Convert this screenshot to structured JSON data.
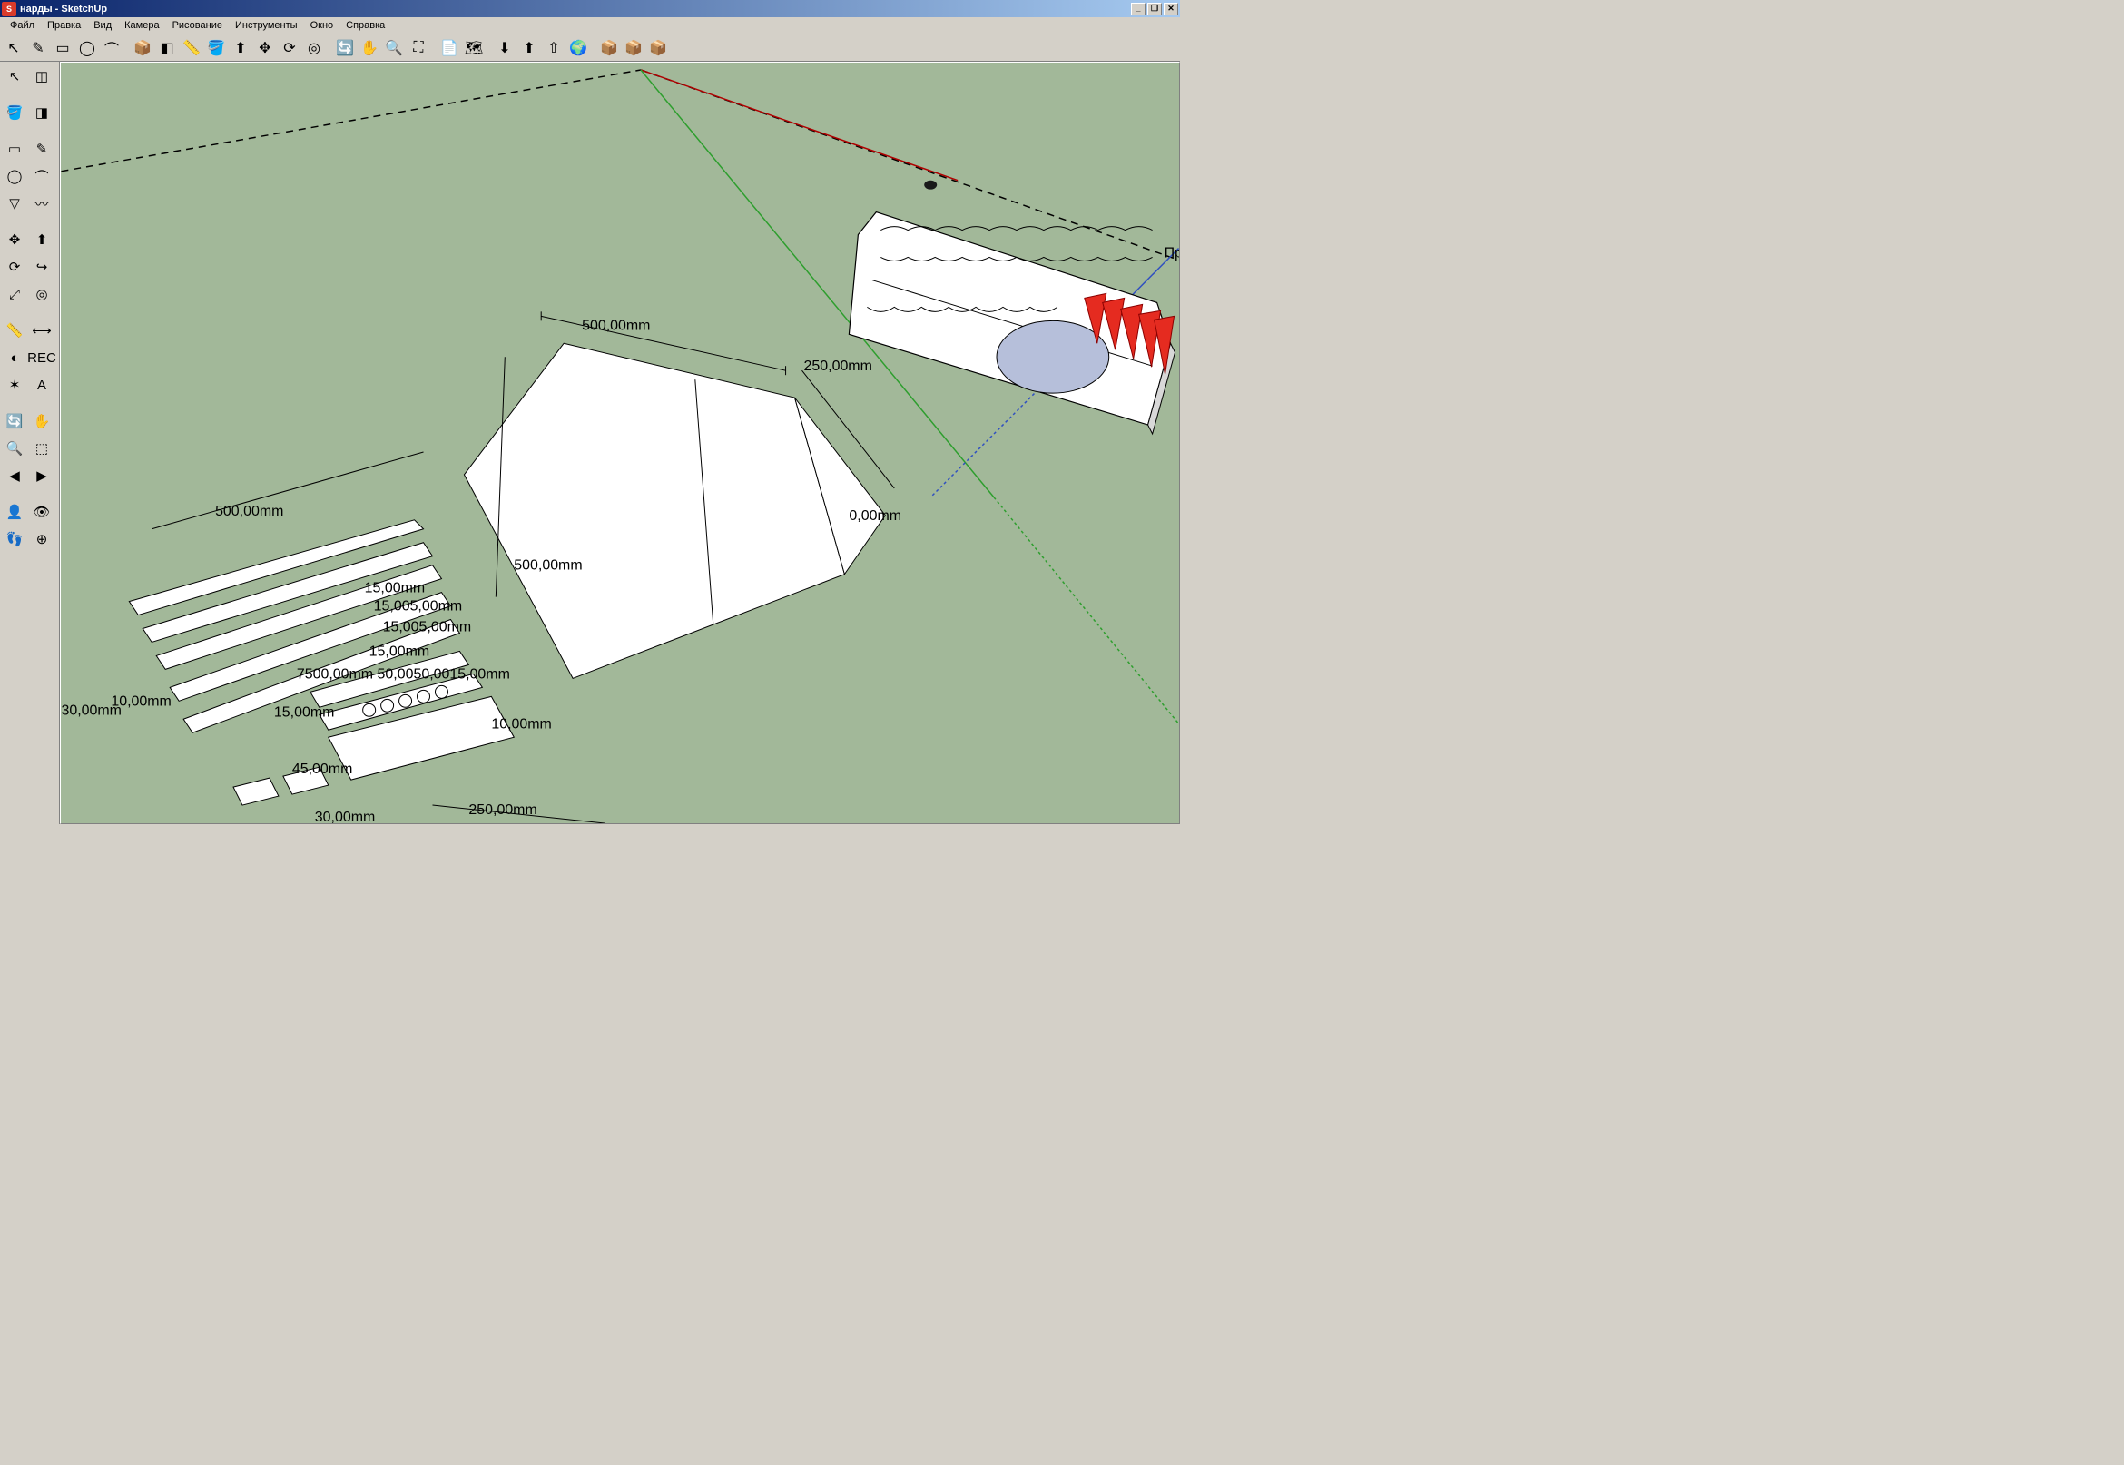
{
  "titlebar": {
    "app_icon_label": "S",
    "title": "нарды - SketchUp"
  },
  "win_buttons": {
    "min": "_",
    "max": "❐",
    "close": "✕"
  },
  "menubar": [
    "Файл",
    "Правка",
    "Вид",
    "Камера",
    "Рисование",
    "Инструменты",
    "Окно",
    "Справка"
  ],
  "top_tools": [
    {
      "name": "select-arrow",
      "glyph": "↖"
    },
    {
      "name": "line-tool",
      "glyph": "✎"
    },
    {
      "name": "rectangle-tool",
      "glyph": "▭"
    },
    {
      "name": "circle-tool",
      "glyph": "◯"
    },
    {
      "name": "arc-tool",
      "glyph": "⌒"
    },
    {
      "sep": true
    },
    {
      "name": "make-component",
      "glyph": "📦"
    },
    {
      "name": "eraser-tool",
      "glyph": "◧"
    },
    {
      "name": "tape-measure",
      "glyph": "📏"
    },
    {
      "name": "paint-bucket",
      "glyph": "🪣"
    },
    {
      "name": "push-pull",
      "glyph": "⬆"
    },
    {
      "name": "move-tool",
      "glyph": "✥"
    },
    {
      "name": "rotate-tool",
      "glyph": "⟳"
    },
    {
      "name": "offset-tool",
      "glyph": "◎"
    },
    {
      "sep": true
    },
    {
      "name": "orbit-tool",
      "glyph": "🔄"
    },
    {
      "name": "pan-tool",
      "glyph": "✋"
    },
    {
      "name": "zoom-tool",
      "glyph": "🔍"
    },
    {
      "name": "zoom-extents",
      "glyph": "⛶"
    },
    {
      "sep": true
    },
    {
      "name": "add-location",
      "glyph": "📄"
    },
    {
      "name": "toggle-terrain",
      "glyph": "🗺"
    },
    {
      "sep": true
    },
    {
      "name": "get-models",
      "glyph": "⬇"
    },
    {
      "name": "share-model",
      "glyph": "⬆"
    },
    {
      "name": "upload-component",
      "glyph": "⇧"
    },
    {
      "name": "preview-ge",
      "glyph": "🌍"
    },
    {
      "sep": true
    },
    {
      "name": "extension-1",
      "glyph": "📦"
    },
    {
      "name": "extension-2",
      "glyph": "📦"
    },
    {
      "name": "extension-3",
      "glyph": "📦"
    }
  ],
  "side_tools": [
    [
      {
        "name": "select-tool",
        "glyph": "↖"
      },
      {
        "name": "component-tool",
        "glyph": "◫"
      }
    ],
    "gap",
    [
      {
        "name": "paint-bucket-side",
        "glyph": "🪣"
      },
      {
        "name": "eraser-side",
        "glyph": "◨"
      }
    ],
    "gap",
    [
      {
        "name": "rectangle-side",
        "glyph": "▭"
      },
      {
        "name": "line-side",
        "glyph": "✎"
      }
    ],
    [
      {
        "name": "circle-side",
        "glyph": "◯"
      },
      {
        "name": "arc-side",
        "glyph": "⌒"
      }
    ],
    [
      {
        "name": "polygon-side",
        "glyph": "▽"
      },
      {
        "name": "freehand-side",
        "glyph": "〰"
      }
    ],
    "gap",
    [
      {
        "name": "move-side",
        "glyph": "✥"
      },
      {
        "name": "pushpull-side",
        "glyph": "⬆"
      }
    ],
    [
      {
        "name": "rotate-side",
        "glyph": "⟳"
      },
      {
        "name": "followme-side",
        "glyph": "↪"
      }
    ],
    [
      {
        "name": "scale-side",
        "glyph": "⤢"
      },
      {
        "name": "offset-side",
        "glyph": "◎"
      }
    ],
    "gap",
    [
      {
        "name": "tape-side",
        "glyph": "📏"
      },
      {
        "name": "dimension-side",
        "glyph": "⟷"
      }
    ],
    [
      {
        "name": "protractor-side",
        "glyph": "◐"
      },
      {
        "name": "text-side",
        "glyph": "REC"
      }
    ],
    [
      {
        "name": "axes-side",
        "glyph": "✶"
      },
      {
        "name": "3dtext-side",
        "glyph": "A"
      }
    ],
    "gap",
    [
      {
        "name": "orbit-side",
        "glyph": "🔄"
      },
      {
        "name": "pan-side",
        "glyph": "✋"
      }
    ],
    [
      {
        "name": "zoom-side",
        "glyph": "🔍"
      },
      {
        "name": "zoomwindow-side",
        "glyph": "⬚"
      }
    ],
    [
      {
        "name": "prev-side",
        "glyph": "◀"
      },
      {
        "name": "next-side",
        "glyph": "▶"
      }
    ],
    "gap",
    [
      {
        "name": "position-camera",
        "glyph": "👤"
      },
      {
        "name": "look-around",
        "glyph": "👁"
      }
    ],
    [
      {
        "name": "walk-side",
        "glyph": "👣"
      },
      {
        "name": "section-side",
        "glyph": "⊕"
      }
    ]
  ],
  "viewport": {
    "axis_label": "Пр",
    "dimensions": {
      "d500_1": "500,00mm",
      "d500_2": "500,00mm",
      "d500_3": "500,00mm",
      "d250_1": "250,00mm",
      "d250_2": "250,00mm",
      "d0": "0,00mm",
      "d10_1": "10,00mm",
      "d10_2": "10,00mm",
      "d30": "30,00mm",
      "d30_2": "30,00mm",
      "d15_1": "15,00mm",
      "d15_2": "15,00mm",
      "d15_3": "15,00mm",
      "d45": "45,00mm",
      "cluster1": "15,005,00mm",
      "cluster2": "15,005,00mm",
      "cluster3": "7500,00mm 50,0050,0015,00mm"
    }
  }
}
